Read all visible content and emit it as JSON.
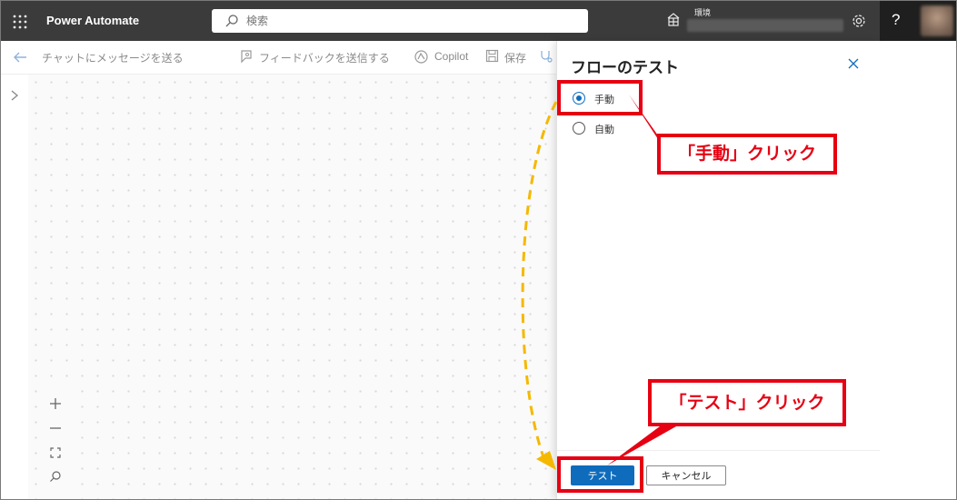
{
  "header": {
    "app_name": "Power Automate",
    "search_placeholder": "検索",
    "env_label": "環境",
    "help_label": "?",
    "bg_color": "#3b3b3b"
  },
  "toolbar": {
    "chat": "チャットにメッセージを送る",
    "feedback": "フィードバックを送信する",
    "copilot": "Copilot",
    "save": "保存"
  },
  "panel": {
    "title": "フローのテスト",
    "options": [
      {
        "label": "手動",
        "checked": true
      },
      {
        "label": "自動",
        "checked": false
      }
    ],
    "test_button": "テスト",
    "cancel_button": "キャンセル"
  },
  "annotations": {
    "manual_click": "「手動」クリック",
    "test_click": "「テスト」クリック",
    "highlight_color": "#e60012",
    "arrow_color": "#f5b800"
  },
  "colors": {
    "accent": "#0f6cbd"
  }
}
